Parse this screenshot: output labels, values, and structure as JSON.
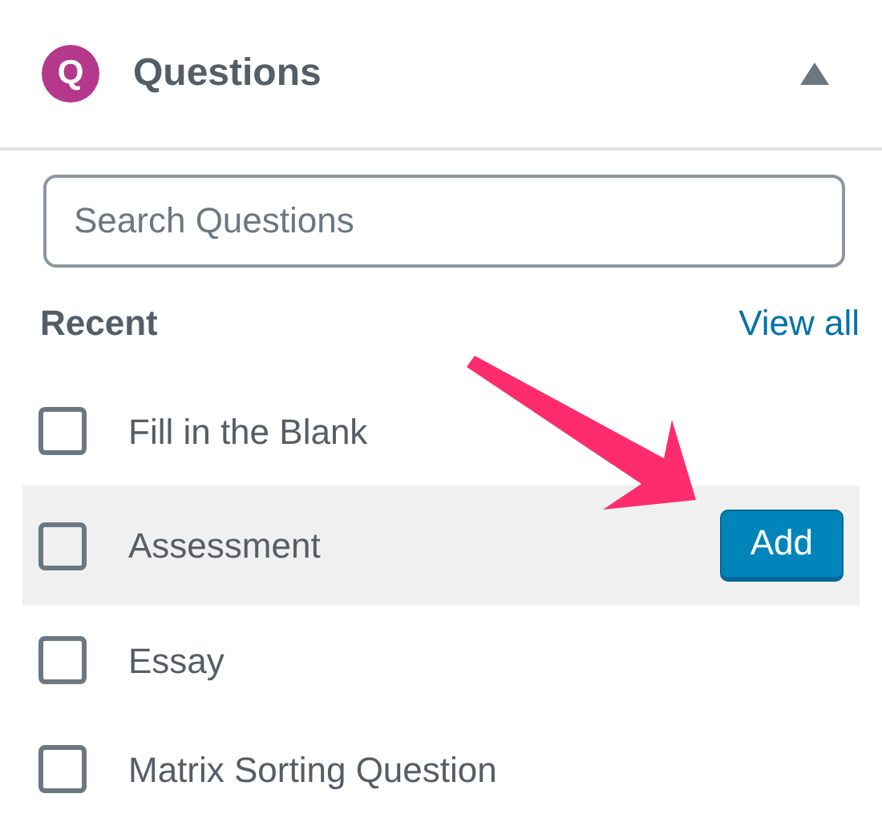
{
  "panel": {
    "badge_letter": "Q",
    "title": "Questions",
    "expanded": true
  },
  "search": {
    "placeholder": "Search Questions"
  },
  "recent": {
    "heading": "Recent",
    "view_all": "View all"
  },
  "questions": [
    {
      "label": "Fill in the Blank",
      "checked": false,
      "highlighted": false
    },
    {
      "label": "Assessment",
      "checked": false,
      "highlighted": true,
      "action": "Add"
    },
    {
      "label": "Essay",
      "checked": false,
      "highlighted": false
    },
    {
      "label": "Matrix Sorting Question",
      "checked": false,
      "highlighted": false
    }
  ]
}
